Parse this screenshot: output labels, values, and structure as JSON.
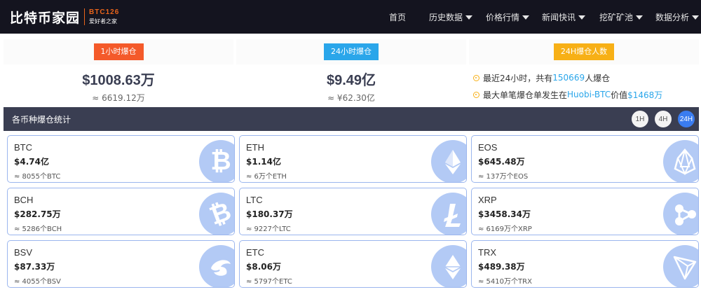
{
  "header": {
    "logo_text": "比特币家园",
    "logo_code": "BTC126",
    "logo_slogan": "爱好者之家",
    "menu": [
      {
        "label": "首页",
        "dropdown": false
      },
      {
        "label": "历史数据",
        "dropdown": true
      },
      {
        "label": "价格行情",
        "dropdown": true
      },
      {
        "label": "新闻快讯",
        "dropdown": true
      },
      {
        "label": "挖矿矿池",
        "dropdown": true
      },
      {
        "label": "数据分析",
        "dropdown": true
      }
    ]
  },
  "summary": {
    "hour": {
      "badge": "1小时爆仓",
      "value": "$1008.63万",
      "sub": "≈ 6619.12万"
    },
    "day": {
      "badge": "24小时爆仓",
      "value": "$9.49亿",
      "sub": "≈ ¥62.30亿"
    },
    "people": {
      "badge": "24H爆仓人数",
      "line1_prefix": "最近24小时，共有",
      "line1_count": "150669",
      "line1_suffix": "人爆仓",
      "line2_prefix": "最大单笔爆仓单发生在",
      "line2_exchange": "Huobi-BTC",
      "line2_mid": "价值",
      "line2_value": "$1468万"
    }
  },
  "section": {
    "title": "各币种爆仓统计",
    "toggles": [
      "1H",
      "4H",
      "24H"
    ],
    "active_toggle": "24H"
  },
  "coins": [
    {
      "name": "BTC",
      "value": "$4.74亿",
      "amount": "≈ 8055个BTC",
      "icon": "bitcoin-icon"
    },
    {
      "name": "ETH",
      "value": "$1.14亿",
      "amount": "≈ 6万个ETH",
      "icon": "ethereum-icon"
    },
    {
      "name": "EOS",
      "value": "$645.48万",
      "amount": "≈ 137万个EOS",
      "icon": "eos-icon"
    },
    {
      "name": "BCH",
      "value": "$282.75万",
      "amount": "≈ 5286个BCH",
      "icon": "bitcoin-cash-icon"
    },
    {
      "name": "LTC",
      "value": "$180.37万",
      "amount": "≈ 9227个LTC",
      "icon": "litecoin-icon"
    },
    {
      "name": "XRP",
      "value": "$3458.34万",
      "amount": "≈ 6169万个XRP",
      "icon": "ripple-icon"
    },
    {
      "name": "BSV",
      "value": "$87.33万",
      "amount": "≈ 4055个BSV",
      "icon": "bitcoin-sv-icon"
    },
    {
      "name": "ETC",
      "value": "$8.06万",
      "amount": "≈ 5797个ETC",
      "icon": "ethereum-classic-icon"
    },
    {
      "name": "TRX",
      "value": "$489.38万",
      "amount": "≈ 5410万个TRX",
      "icon": "tron-icon"
    }
  ],
  "colors": {
    "nav_bg": "#14141f",
    "accent_orange": "#f45a2a",
    "accent_blue": "#2aa6ea",
    "accent_yellow": "#f7b016",
    "section_bg": "#3a3e52",
    "toggle_active": "#3a7cf0",
    "card_border": "#9bb6ee",
    "icon_bg": "#b3caf5"
  }
}
